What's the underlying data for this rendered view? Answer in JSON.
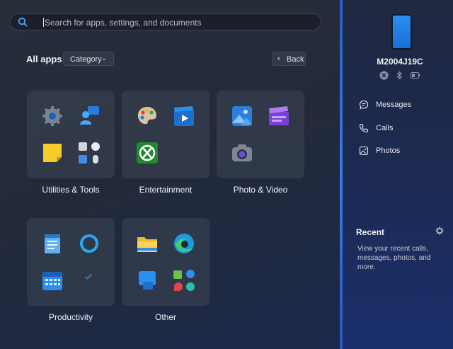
{
  "search": {
    "placeholder": "Search for apps, settings, and documents"
  },
  "header": {
    "title": "All apps",
    "category_label": "Category",
    "back_label": "Back"
  },
  "groups": [
    {
      "label": "Utilities & Tools"
    },
    {
      "label": "Entertainment"
    },
    {
      "label": "Photo & Video"
    },
    {
      "label": "Productivity"
    },
    {
      "label": "Other"
    }
  ],
  "phone": {
    "model": "M2004J19C",
    "nav": [
      {
        "label": "Messages"
      },
      {
        "label": "Calls"
      },
      {
        "label": "Photos"
      }
    ],
    "recent_title": "Recent",
    "recent_desc": "View your recent calls, messages, photos, and more."
  },
  "colors": {
    "accent": "#2b8ff0",
    "divider": "#3b7ae0"
  }
}
